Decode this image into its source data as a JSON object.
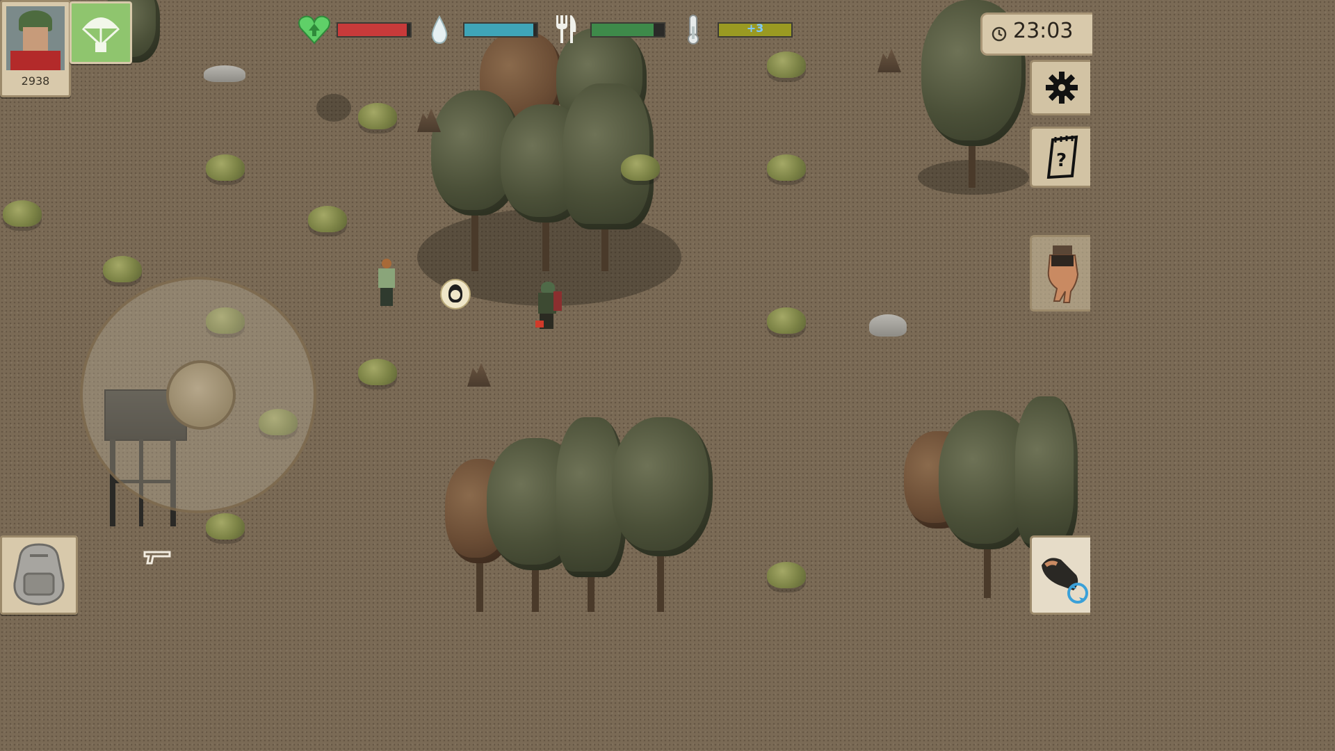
{
  "player": {
    "avatar_icon": "soldier-portrait-icon",
    "score": "2938"
  },
  "airdrop": {
    "icon": "parachute-icon"
  },
  "stats": {
    "health": {
      "icon": "heart-arrow-icon",
      "level": 0.95,
      "color": "#c83a3a"
    },
    "water": {
      "icon": "water-drop-icon",
      "level": 0.95,
      "color": "#3fa5b8"
    },
    "food": {
      "icon": "fork-knife-icon",
      "level": 0.86,
      "color": "#3e8a4a"
    },
    "temperature": {
      "icon": "thermometer-icon",
      "label": "+3",
      "level": 1.0,
      "color": "#9a9a22"
    }
  },
  "clock": {
    "icon": "clock-icon",
    "time": "23:03"
  },
  "buttons": {
    "settings": "gear-icon",
    "quests": "quest-notebook-icon",
    "craft": "hand-icon",
    "inventory": "backpack-icon",
    "attack": "fist-swap-icon"
  },
  "joystick": {
    "icon": "joystick-icon"
  },
  "weapon": {
    "icon": "pistol-icon"
  },
  "npc_marker": {
    "icon": "npc-face-icon"
  }
}
